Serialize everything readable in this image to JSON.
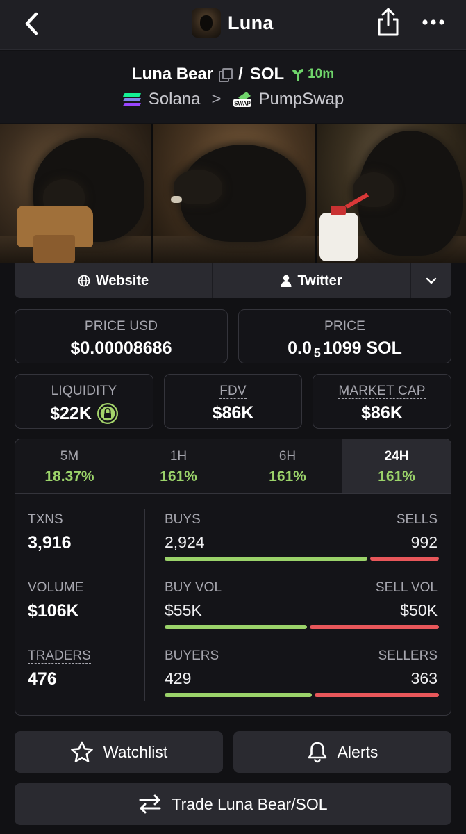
{
  "nav": {
    "title": "Luna"
  },
  "pair": {
    "base": "Luna Bear",
    "separator": "/",
    "quote": "SOL",
    "age": "10m",
    "chain": "Solana",
    "chevron": ">",
    "dex": "PumpSwap",
    "dex_icon_text": "SWAP"
  },
  "links": {
    "website": "Website",
    "twitter": "Twitter"
  },
  "stats": {
    "price_usd_label": "PRICE USD",
    "price_usd": "$0.00008686",
    "price_label": "PRICE",
    "price_prefix": "0.0",
    "price_zeros": "5",
    "price_suffix": "1099 SOL",
    "liquidity_label": "LIQUIDITY",
    "liquidity": "$22K",
    "fdv_label": "FDV",
    "fdv": "$86K",
    "mcap_label": "MARKET CAP",
    "mcap": "$86K"
  },
  "periods": [
    {
      "label": "5M",
      "change": "18.37%"
    },
    {
      "label": "1H",
      "change": "161%"
    },
    {
      "label": "6H",
      "change": "161%"
    },
    {
      "label": "24H",
      "change": "161%",
      "active": true
    }
  ],
  "metrics": {
    "txns_label": "TXNS",
    "txns": "3,916",
    "volume_label": "VOLUME",
    "volume": "$106K",
    "traders_label": "TRADERS",
    "traders": "476",
    "buys_label": "BUYS",
    "buys": "2,924",
    "sells_label": "SELLS",
    "sells": "992",
    "buys_fraction": 0.747,
    "buy_vol_label": "BUY VOL",
    "buy_vol": "$55K",
    "sell_vol_label": "SELL VOL",
    "sell_vol": "$50K",
    "buy_vol_fraction": 0.524,
    "buyers_label": "BUYERS",
    "buyers": "429",
    "sellers_label": "SELLERS",
    "sellers": "363",
    "buyers_fraction": 0.542
  },
  "actions": {
    "watchlist": "Watchlist",
    "alerts": "Alerts",
    "trade": "Trade Luna Bear/SOL"
  },
  "colors": {
    "positive": "#9bd36a",
    "negative": "#e8575a",
    "accent_green": "#6fd46b"
  },
  "icons": [
    "back-chevron-icon",
    "share-icon",
    "more-icon",
    "copy-icon",
    "seedling-icon",
    "solana-icon",
    "pumpswap-icon",
    "globe-icon",
    "user-icon",
    "chevron-down-icon",
    "lock-icon",
    "star-icon",
    "bell-icon",
    "swap-arrows-icon"
  ]
}
